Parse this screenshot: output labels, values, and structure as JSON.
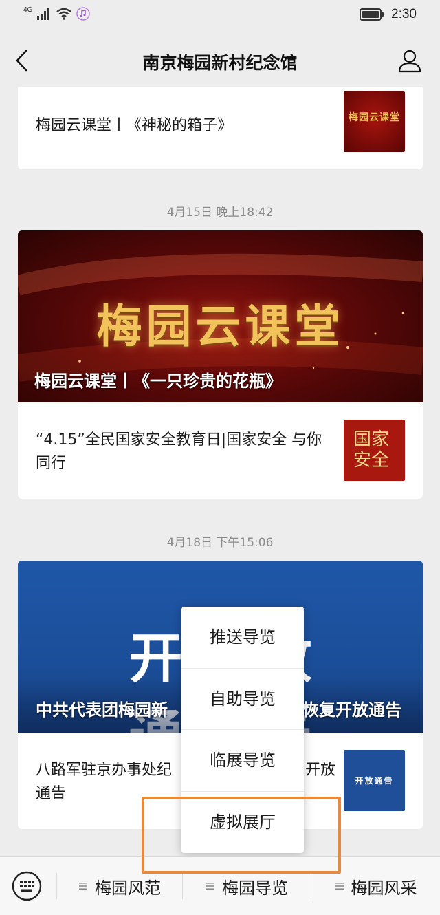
{
  "status_bar": {
    "network": "4G",
    "time": "2:30",
    "icons": [
      "signal-icon",
      "wifi-icon",
      "music-icon",
      "battery-icon"
    ]
  },
  "nav": {
    "title": "南京梅园新村纪念馆",
    "back_icon": "chevron-left-icon",
    "profile_icon": "person-icon"
  },
  "feed": {
    "group0": {
      "item_title": "梅园云课堂丨《神秘的箱子》",
      "thumb_text": "梅园云课堂"
    },
    "group1": {
      "time": "4月15日 晚上18:42",
      "banner_text": "梅园云课堂",
      "banner_caption": "梅园云课堂丨《一只珍贵的花瓶》",
      "item_title": "“4.15”全民国家安全教育日|国家安全 与你同行",
      "thumb_text": "国家安全"
    },
    "group2": {
      "time": "4月18日 下午15:06",
      "banner_text": "开放通告",
      "banner_caption_left": "中共代表团梅园新",
      "banner_caption_right": "恢复开放通告",
      "item_title_left_line1": "八路军驻京办事处纪",
      "item_title_right_line1": "开放",
      "item_title_line2": "通告",
      "thumb_text": "开放通告"
    }
  },
  "popup_menu": {
    "items": [
      "推送导览",
      "自助导览",
      "临展导览",
      "虚拟展厅"
    ]
  },
  "bottom_bar": {
    "keyboard_icon": "keyboard-icon",
    "tabs": [
      "梅园风范",
      "梅园导览",
      "梅园风采"
    ]
  },
  "colors": {
    "background": "#ededed",
    "highlight": "#e8893c",
    "red_banner": "#7a0e0b",
    "blue_banner": "#1d52a0"
  }
}
